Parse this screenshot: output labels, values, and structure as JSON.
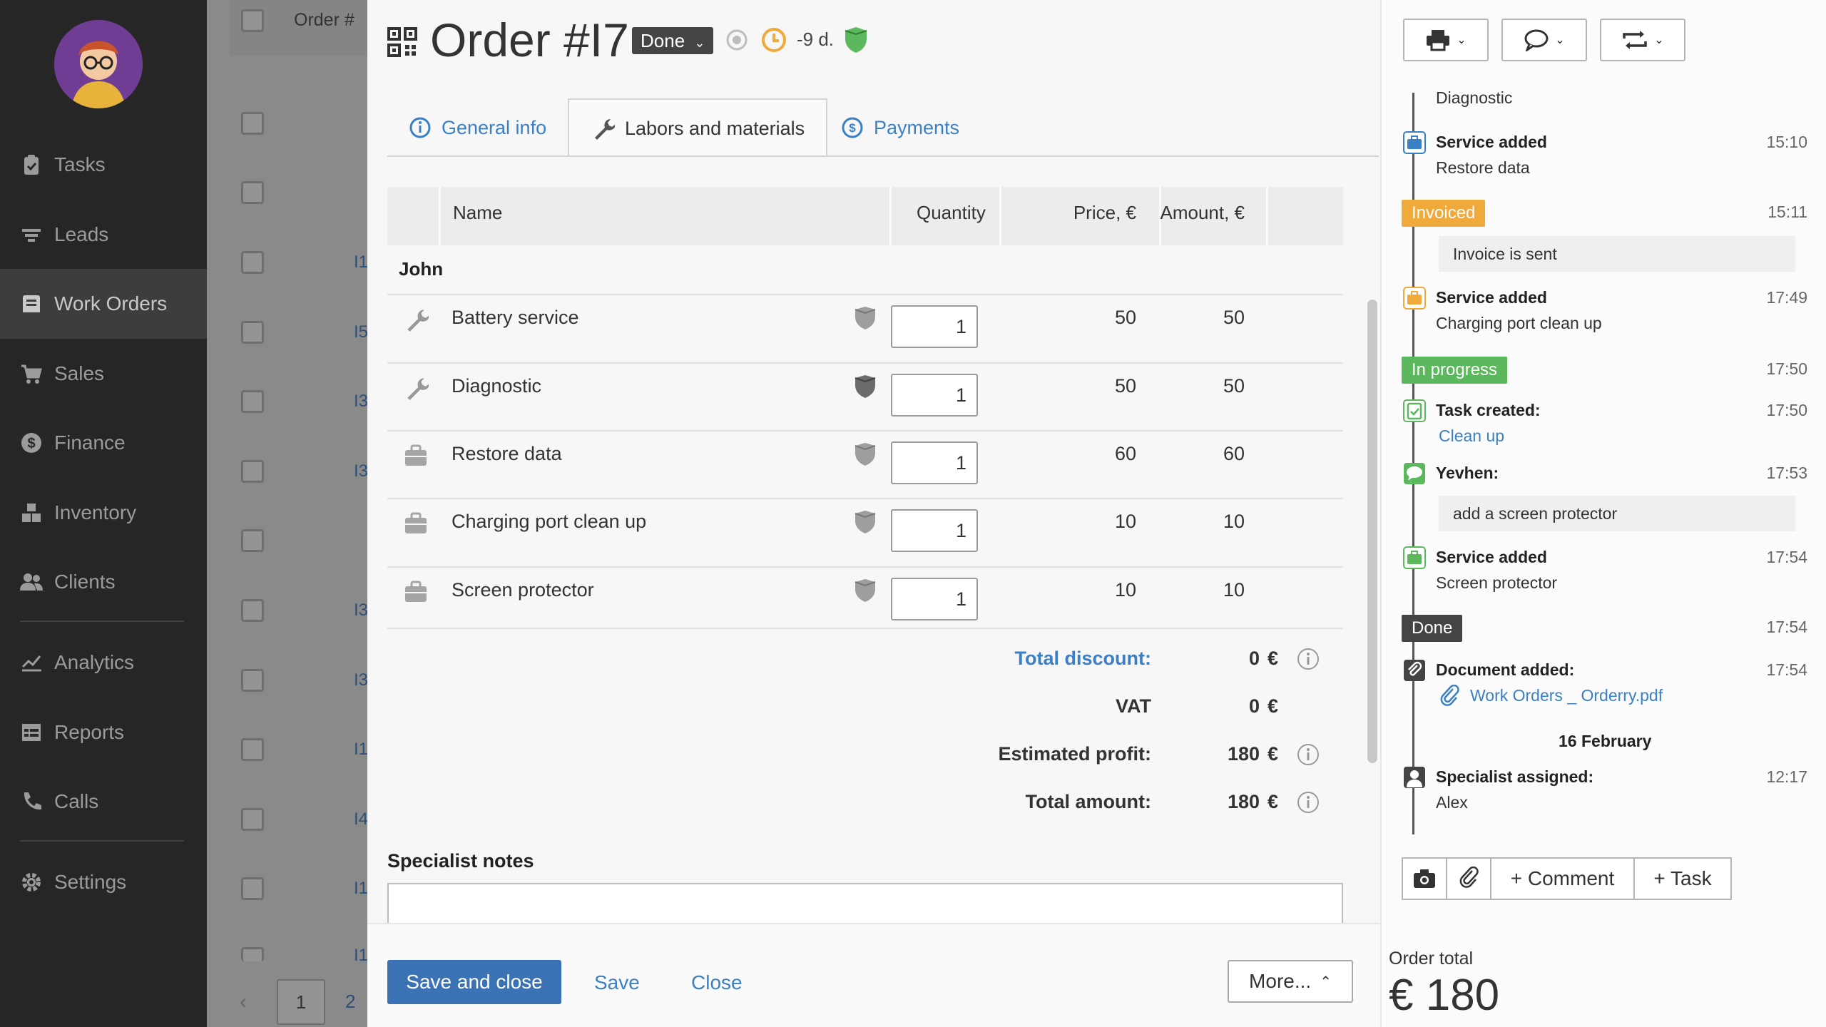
{
  "sidebar": {
    "items": [
      {
        "label": "Tasks",
        "icon": "clipboard-check-icon"
      },
      {
        "label": "Leads",
        "icon": "filter-icon"
      },
      {
        "label": "Work Orders",
        "icon": "work-order-icon"
      },
      {
        "label": "Sales",
        "icon": "cart-icon"
      },
      {
        "label": "Finance",
        "icon": "dollar-circle-icon"
      },
      {
        "label": "Inventory",
        "icon": "boxes-icon"
      },
      {
        "label": "Clients",
        "icon": "users-icon"
      },
      {
        "label": "Analytics",
        "icon": "chart-line-icon"
      },
      {
        "label": "Reports",
        "icon": "report-table-icon"
      },
      {
        "label": "Calls",
        "icon": "phone-icon"
      },
      {
        "label": "Settings",
        "icon": "gear-icon"
      }
    ],
    "active": "Work Orders"
  },
  "background_list": {
    "header": "Order #",
    "fragments": [
      "I1",
      "I5",
      "I3",
      "I3",
      "I3",
      "I3",
      "I1",
      "I4",
      "I1",
      "I1"
    ],
    "pagination": [
      "1",
      "2"
    ]
  },
  "order": {
    "title": "Order #I7",
    "status": "Done",
    "due": "-9 d."
  },
  "tabs": [
    {
      "label": "General info",
      "icon": "info-circle-icon"
    },
    {
      "label": "Labors and materials",
      "icon": "wrench-icon"
    },
    {
      "label": "Payments",
      "icon": "dollar-circle-icon"
    }
  ],
  "table": {
    "columns": {
      "name": "Name",
      "quantity": "Quantity",
      "price": "Price, €",
      "amount": "Amount, €"
    },
    "group": "John",
    "rows": [
      {
        "name": "Battery service",
        "type": "labor",
        "qty": "1",
        "price": "50",
        "amount": "50"
      },
      {
        "name": "Diagnostic",
        "type": "labor",
        "qty": "1",
        "price": "50",
        "amount": "50"
      },
      {
        "name": "Restore data",
        "type": "service",
        "qty": "1",
        "price": "60",
        "amount": "60"
      },
      {
        "name": "Charging port clean up",
        "type": "service",
        "qty": "1",
        "price": "10",
        "amount": "10"
      },
      {
        "name": "Screen protector",
        "type": "service",
        "qty": "1",
        "price": "10",
        "amount": "10"
      }
    ]
  },
  "totals": {
    "discount_label": "Total discount:",
    "discount": "0",
    "vat_label": "VAT",
    "vat": "0",
    "profit_label": "Estimated profit:",
    "profit": "180",
    "total_label": "Total amount:",
    "total": "180",
    "currency": "€"
  },
  "notes": {
    "label": "Specialist notes",
    "value": ""
  },
  "footer": {
    "save_close": "Save and close",
    "save": "Save",
    "close": "Close",
    "more": "More..."
  },
  "timeline": {
    "events": [
      {
        "kind": "sub",
        "text": "Diagnostic"
      },
      {
        "kind": "service",
        "title": "Service added",
        "sub": "Restore data",
        "time": "15:10"
      },
      {
        "kind": "badge",
        "label": "Invoiced",
        "color": "#f0a93b",
        "time": "15:11",
        "box": "Invoice is sent"
      },
      {
        "kind": "service",
        "title": "Service added",
        "sub": "Charging port clean up",
        "time": "17:49"
      },
      {
        "kind": "badge",
        "label": "In progress",
        "color": "#5cb85c",
        "time": "17:50"
      },
      {
        "kind": "task",
        "title": "Task created:",
        "link": "Clean up",
        "time": "17:50"
      },
      {
        "kind": "comment",
        "title": "Yevhen:",
        "time": "17:53",
        "box": "add a screen protector"
      },
      {
        "kind": "service",
        "title": "Service added",
        "sub": "Screen protector",
        "time": "17:54"
      },
      {
        "kind": "badge",
        "label": "Done",
        "color": "#444444",
        "time": "17:54"
      },
      {
        "kind": "document",
        "title": "Document added:",
        "link": "Work Orders _ Orderry.pdf",
        "time": "17:54"
      },
      {
        "kind": "date",
        "text": "16 February"
      },
      {
        "kind": "specialist",
        "title": "Specialist assigned:",
        "sub": "Alex",
        "time": "12:17"
      }
    ]
  },
  "actions": {
    "comment": "+ Comment",
    "task": "+ Task"
  },
  "order_total": {
    "label": "Order total",
    "value": "€ 180"
  },
  "colors": {
    "accent": "#3b7fc4",
    "primary_button": "#3a72b3",
    "invoiced": "#f0a93b",
    "in_progress": "#5cb85c",
    "done": "#444444",
    "service_icon": "#f0a93b",
    "shield": "#5cb85c"
  }
}
